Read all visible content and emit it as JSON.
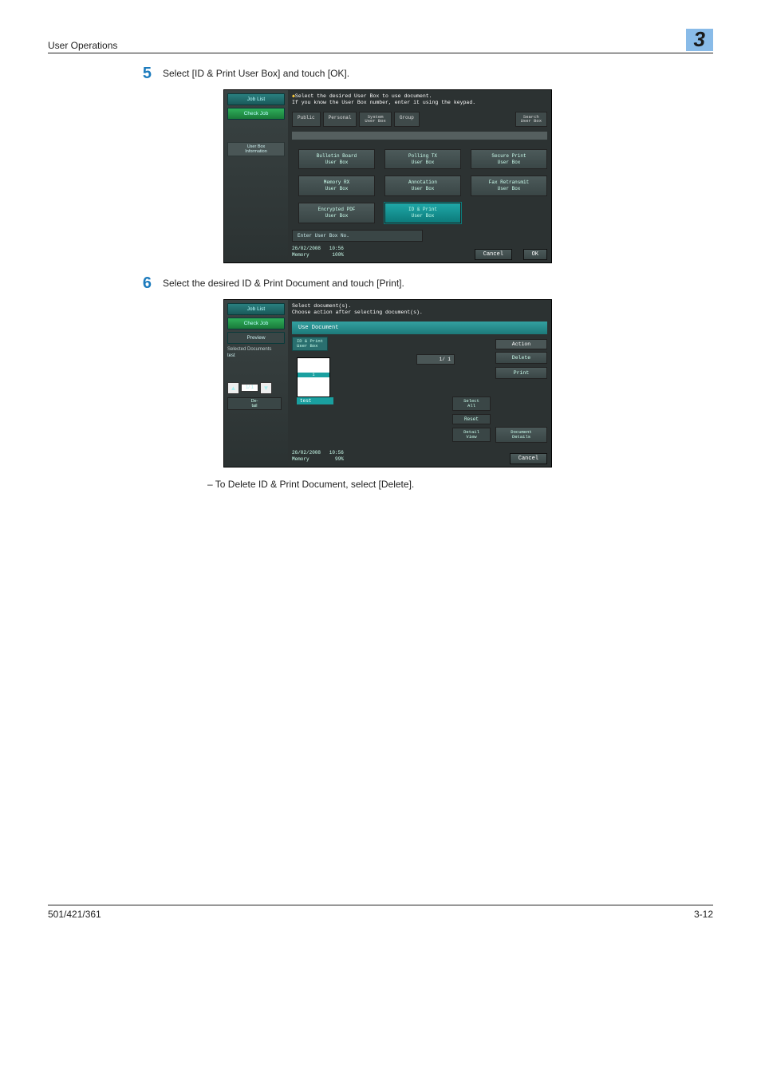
{
  "header": {
    "section": "User Operations",
    "chapter": "3"
  },
  "step5": {
    "num": "5",
    "text": "Select [ID & Print User Box] and touch [OK]."
  },
  "shot1": {
    "left": {
      "job_list": "Job List",
      "check_job": "Check Job",
      "user_box_info": "User Box\nInformation"
    },
    "msg1": "Select the desired User Box to use document.",
    "msg2": "If you know the User Box number, enter it using the keypad.",
    "tabs": {
      "public": "Public",
      "personal": "Personal",
      "system": "System\nUser Box",
      "group": "Group",
      "search": "Search\nUser Box"
    },
    "grid": {
      "b1": "Bulletin Board\nUser Box",
      "b2": "Polling TX\nUser Box",
      "b3": "Secure Print\nUser Box",
      "b4": "Memory RX\nUser Box",
      "b5": "Annotation\nUser Box",
      "b6": "Fax Retransmit\nUser Box",
      "b7": "Encrypted PDF\nUser Box",
      "b8": "ID & Print\nUser Box"
    },
    "enter": "Enter User Box No.",
    "meta": "26/02/2008   10:56\nMemory        100%",
    "cancel": "Cancel",
    "ok": "OK"
  },
  "step6": {
    "num": "6",
    "text": "Select the desired ID & Print Document and touch [Print]."
  },
  "shot2": {
    "left": {
      "job_list": "Job List",
      "check_job": "Check Job",
      "preview": "Preview",
      "sel": "Selected Documents",
      "test": "test",
      "pager": "1/  1",
      "detail": "De-\ntail"
    },
    "msg1": "Select document(s).",
    "msg2": "Choose action after selecting document(s).",
    "use_doc": "Use Document",
    "sub_tab": "ID & Print\nUser Box",
    "thumb": {
      "band": "1",
      "label": "test"
    },
    "page_ind": "1/  1",
    "action": "Action",
    "delete": "Delete",
    "print": "Print",
    "select_all": "Select\nAll",
    "reset": "Reset",
    "detail_view": "Detail\nView",
    "doc_details": "Document\nDetails",
    "meta": "26/02/2008   10:56\nMemory         99%",
    "cancel": "Cancel"
  },
  "note": "–   To Delete ID & Print Document, select [Delete].",
  "footer": {
    "left": "501/421/361",
    "right": "3-12"
  }
}
